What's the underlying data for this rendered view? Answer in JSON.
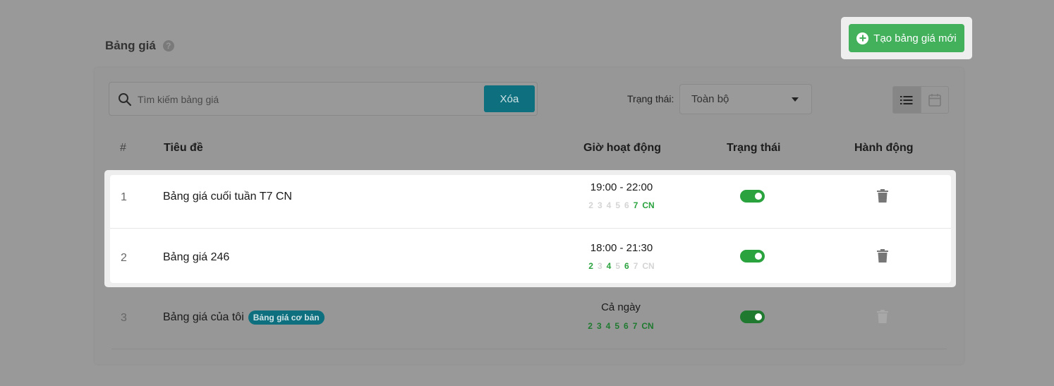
{
  "page": {
    "title": "Bảng giá",
    "help_icon": "question-circle-icon",
    "create_button": "Tạo bảng giá mới"
  },
  "toolbar": {
    "search_placeholder": "Tìm kiếm bảng giá",
    "clear_label": "Xóa",
    "status_label": "Trạng thái:",
    "status_value": "Toàn bộ"
  },
  "table": {
    "headers": {
      "index": "#",
      "title": "Tiêu đề",
      "hours": "Giờ hoạt động",
      "status": "Trạng thái",
      "action": "Hành động"
    },
    "day_labels": [
      "2",
      "3",
      "4",
      "5",
      "6",
      "7",
      "CN"
    ],
    "rows": [
      {
        "index": "1",
        "title": "Bảng giá cuối tuần T7 CN",
        "badge": "",
        "hours": "19:00 - 22:00",
        "active_days": [
          false,
          false,
          false,
          false,
          false,
          true,
          true
        ],
        "enabled": true
      },
      {
        "index": "2",
        "title": "Bảng giá 246",
        "badge": "",
        "hours": "18:00 - 21:30",
        "active_days": [
          true,
          false,
          true,
          false,
          true,
          false,
          false
        ],
        "enabled": true
      },
      {
        "index": "3",
        "title": "Bảng giá của tôi",
        "badge": "Bảng giá cơ bản",
        "hours": "Cả ngày",
        "active_days": [
          true,
          true,
          true,
          true,
          true,
          true,
          true
        ],
        "enabled": true
      }
    ]
  },
  "colors": {
    "accent_green": "#43b05c",
    "teal": "#0e6f7e",
    "day_on": "#2aa33f",
    "day_off": "#d4d4d4"
  }
}
